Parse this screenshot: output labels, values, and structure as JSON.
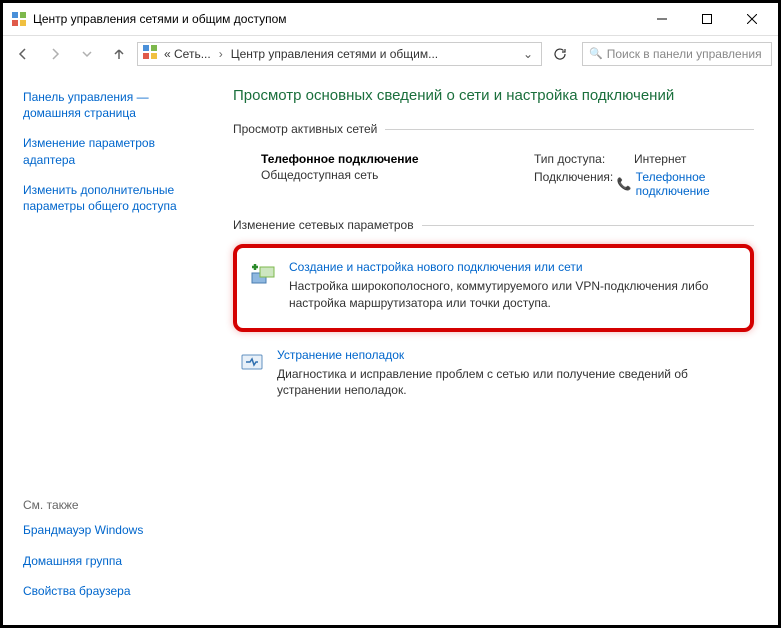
{
  "title": "Центр управления сетями и общим доступом",
  "breadcrumb": {
    "root": "« Сеть...",
    "current": "Центр управления сетями и общим..."
  },
  "search_placeholder": "Поиск в панели управления",
  "sidebar": {
    "home": "Панель управления — домашняя страница",
    "links": [
      "Изменение параметров адаптера",
      "Изменить дополнительные параметры общего доступа"
    ],
    "seealso_label": "См. также",
    "seealso": [
      "Брандмауэр Windows",
      "Домашняя группа",
      "Свойства браузера"
    ]
  },
  "content": {
    "page_title": "Просмотр основных сведений о сети и настройка подключений",
    "active_label": "Просмотр активных сетей",
    "network": {
      "name": "Телефонное подключение",
      "type": "Общедоступная сеть",
      "access_label": "Тип доступа:",
      "access_value": "Интернет",
      "conn_label": "Подключения:",
      "conn_value": "Телефонное подключение"
    },
    "change_label": "Изменение сетевых параметров",
    "task1": {
      "title": "Создание и настройка нового подключения или сети",
      "desc": "Настройка широкополосного, коммутируемого или VPN-подключения либо настройка маршрутизатора или точки доступа."
    },
    "task2": {
      "title": "Устранение неполадок",
      "desc": "Диагностика и исправление проблем с сетью или получение сведений об устранении неполадок."
    }
  }
}
